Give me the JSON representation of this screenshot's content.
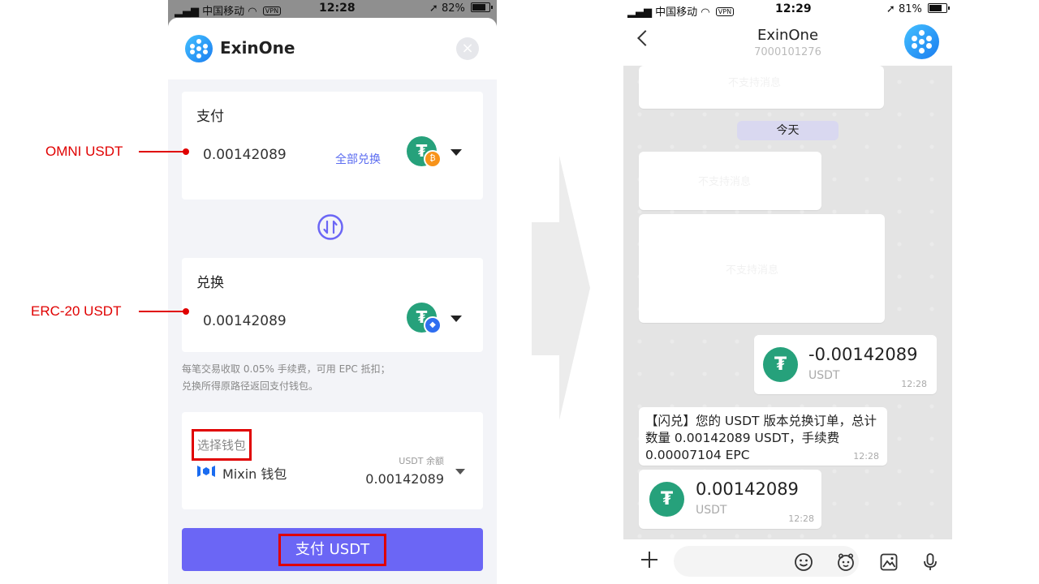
{
  "left": {
    "status": {
      "carrier": "中国移动",
      "vpn": "VPN",
      "time": "12:28",
      "battery": "82%",
      "battery_level": 0.82
    },
    "header": {
      "title": "ExinOne"
    },
    "pay": {
      "label": "支付",
      "amount": "0.00142089",
      "swap_all": "全部兑换"
    },
    "swap": {
      "label": "兑换",
      "amount": "0.00142089"
    },
    "fee_note": {
      "line1": "每笔交易收取 0.05% 手续费，可用 EPC 抵扣；",
      "line2": "兑换所得原路径返回支付钱包。"
    },
    "wallet": {
      "label": "选择钱包",
      "name": "Mixin 钱包",
      "balance_label": "USDT 余额",
      "balance": "0.00142089"
    },
    "pay_button": "支付 USDT"
  },
  "annotations": {
    "omni": "OMNI USDT",
    "erc20": "ERC-20 USDT"
  },
  "right": {
    "status": {
      "carrier": "中国移动",
      "vpn": "VPN",
      "time": "12:29",
      "battery": "81%",
      "battery_level": 0.81
    },
    "header": {
      "title": "ExinOne",
      "subtitle": "7000101276"
    },
    "date_chip": "今天",
    "ghost": "不支持消息",
    "messages": [
      {
        "amount": "-0.00142089",
        "symbol": "USDT",
        "time": "12:28"
      },
      {
        "text": "【闪兑】您的 USDT 版本兑换订单，总计数量 0.00142089 USDT，手续费 0.00007104 EPC",
        "time": "12:28"
      },
      {
        "amount": "0.00142089",
        "symbol": "USDT",
        "time": "12:28"
      }
    ]
  },
  "colors": {
    "accent": "#6b66f5",
    "usdt_green": "#26a17b",
    "annotation_red": "#e00000"
  }
}
